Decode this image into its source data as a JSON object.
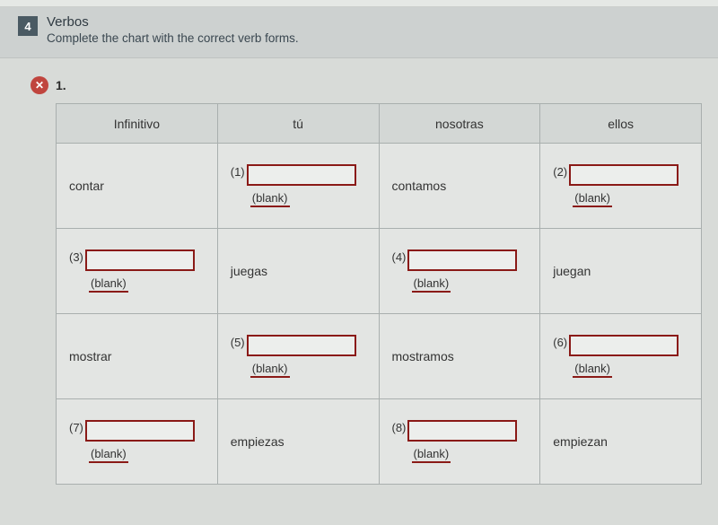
{
  "header": {
    "section_number": "4",
    "title": "Verbos",
    "subtitle": "Complete the chart with the correct verb forms."
  },
  "question": {
    "marker_icon": "✕",
    "number": "1."
  },
  "table": {
    "headers": {
      "infinitivo": "Infinitivo",
      "tu": "tú",
      "nosotras": "nosotras",
      "ellos": "ellos"
    },
    "blank_label": "(blank)",
    "rows": [
      {
        "infinitivo": {
          "type": "text",
          "value": "contar"
        },
        "tu": {
          "type": "blank",
          "num": "(1)"
        },
        "nosotras": {
          "type": "text",
          "value": "contamos"
        },
        "ellos": {
          "type": "blank",
          "num": "(2)"
        }
      },
      {
        "infinitivo": {
          "type": "blank",
          "num": "(3)"
        },
        "tu": {
          "type": "text",
          "value": "juegas"
        },
        "nosotras": {
          "type": "blank",
          "num": "(4)"
        },
        "ellos": {
          "type": "text",
          "value": "juegan"
        }
      },
      {
        "infinitivo": {
          "type": "text",
          "value": "mostrar"
        },
        "tu": {
          "type": "blank",
          "num": "(5)"
        },
        "nosotras": {
          "type": "text",
          "value": "mostramos"
        },
        "ellos": {
          "type": "blank",
          "num": "(6)"
        }
      },
      {
        "infinitivo": {
          "type": "blank",
          "num": "(7)"
        },
        "tu": {
          "type": "text",
          "value": "empiezas"
        },
        "nosotras": {
          "type": "blank",
          "num": "(8)"
        },
        "ellos": {
          "type": "text",
          "value": "empiezan"
        }
      }
    ]
  }
}
